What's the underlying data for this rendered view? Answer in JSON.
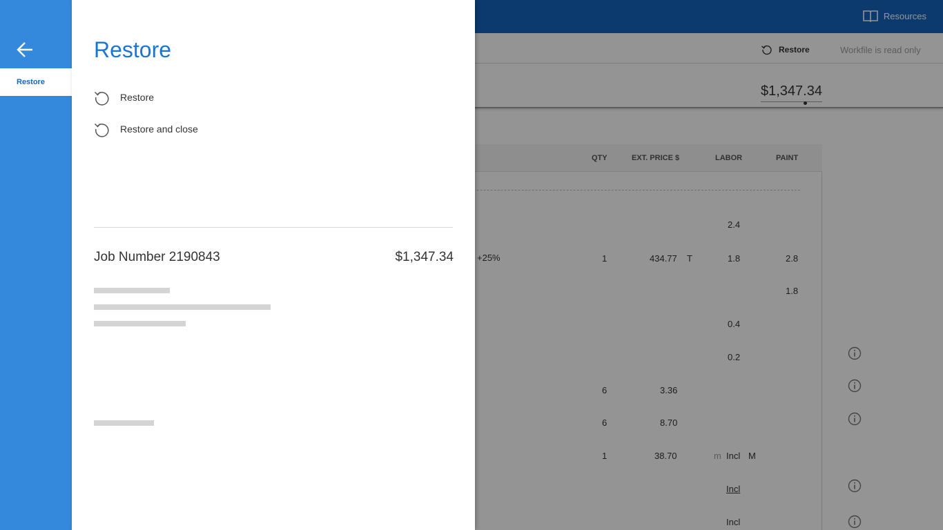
{
  "background": {
    "topbar": {
      "resources_label": "Resources"
    },
    "toolbar": {
      "restore_label": "Restore",
      "readonly_label": "Workfile is read only"
    },
    "total": "$1,347.34",
    "table": {
      "headers": [
        "QTY",
        "EXT. PRICE $",
        "LABOR",
        "PAINT"
      ],
      "rows": [
        {
          "labor": "2.4"
        },
        {
          "note": "+25%",
          "qty": "1",
          "price": "434.77",
          "flag": "T",
          "labor": "1.8",
          "paint": "2.8"
        },
        {
          "paint": "1.8"
        },
        {
          "labor": "0.4"
        },
        {
          "labor": "0.2"
        },
        {
          "qty": "6",
          "price": "3.36"
        },
        {
          "qty": "6",
          "price": "8.70"
        },
        {
          "qty": "1",
          "price": "38.70",
          "labor_prefix": "m",
          "labor": "Incl",
          "labor_suffix": "M"
        },
        {
          "labor": "Incl"
        },
        {
          "labor": "Incl"
        }
      ]
    }
  },
  "drawer": {
    "nav_tab": "Restore",
    "title": "Restore",
    "actions": [
      {
        "label": "Restore"
      },
      {
        "label": "Restore and close"
      }
    ],
    "job": {
      "label": "Job Number 2190843",
      "amount": "$1,347.34"
    }
  },
  "icons": {
    "back": "arrow-left-icon",
    "restore": "restore-icon",
    "resources": "book-icon",
    "info": "info-icon"
  },
  "colors": {
    "primary": "#1565c0",
    "nav_blue": "#3589dc",
    "title_blue": "#1976d2"
  }
}
